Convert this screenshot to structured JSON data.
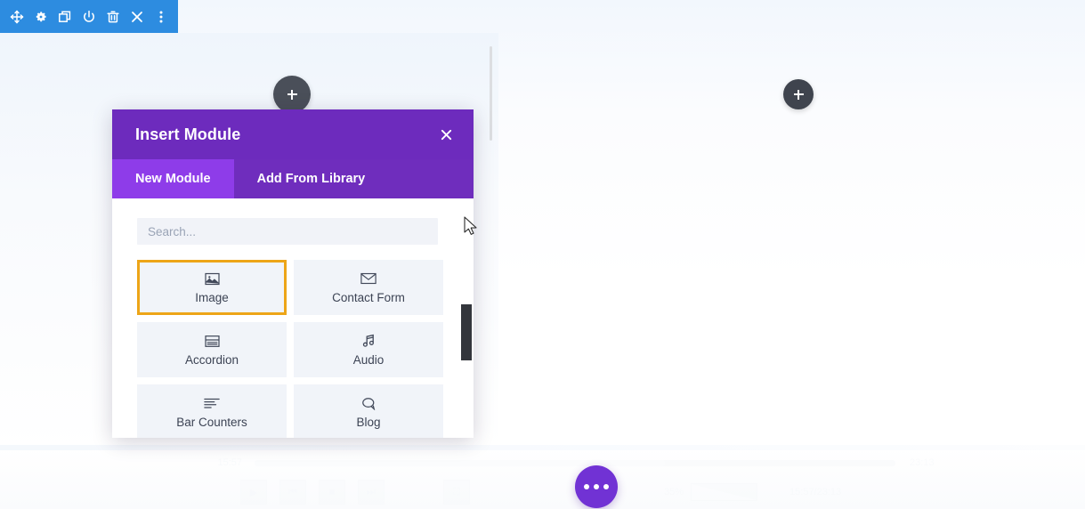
{
  "toolbar": {
    "items": [
      {
        "name": "move-icon",
        "label": "Move"
      },
      {
        "name": "gear-icon",
        "label": "Settings"
      },
      {
        "name": "duplicate-icon",
        "label": "Duplicate"
      },
      {
        "name": "power-icon",
        "label": "Disable"
      },
      {
        "name": "trash-icon",
        "label": "Delete"
      },
      {
        "name": "close-icon",
        "label": "Close"
      },
      {
        "name": "more-vertical-icon",
        "label": "More Options"
      }
    ]
  },
  "canvas": {
    "add_left_label": "+",
    "add_right_label": "+",
    "fab_label": "..."
  },
  "modal": {
    "title": "Insert Module",
    "close_label": "✕",
    "tabs": [
      {
        "label": "New Module",
        "active": true
      },
      {
        "label": "Add From Library",
        "active": false
      }
    ],
    "search": {
      "value": "",
      "placeholder": "Search..."
    },
    "modules": [
      {
        "label": "Image",
        "icon": "image-icon",
        "selected": true
      },
      {
        "label": "Contact Form",
        "icon": "envelope-icon",
        "selected": false
      },
      {
        "label": "Accordion",
        "icon": "accordion-icon",
        "selected": false
      },
      {
        "label": "Audio",
        "icon": "music-note-icon",
        "selected": false
      },
      {
        "label": "Bar Counters",
        "icon": "bars-icon",
        "selected": false
      },
      {
        "label": "Blog",
        "icon": "speech-bubble-icon",
        "selected": false
      }
    ]
  },
  "player": {
    "current_time": "15:57",
    "total_time": "23:13",
    "time_display": "15:57/23:13",
    "volume_percent": "35%",
    "controls": [
      {
        "name": "play-button",
        "glyph": "▶"
      },
      {
        "name": "previous-button",
        "glyph": "⏮"
      },
      {
        "name": "stop-button",
        "glyph": "■"
      },
      {
        "name": "next-button",
        "glyph": "⏭"
      },
      {
        "name": "fullscreen-button",
        "glyph": "⛶"
      },
      {
        "name": "mute-button",
        "glyph": "♪"
      }
    ]
  },
  "colors": {
    "toolbar_blue": "#2d8ce0",
    "modal_purple": "#6d2bbd",
    "tab_active_purple": "#8e3ce9",
    "selected_orange": "#eda518",
    "fab_purple": "#7132d4",
    "tile_bg": "#f1f4f9"
  }
}
